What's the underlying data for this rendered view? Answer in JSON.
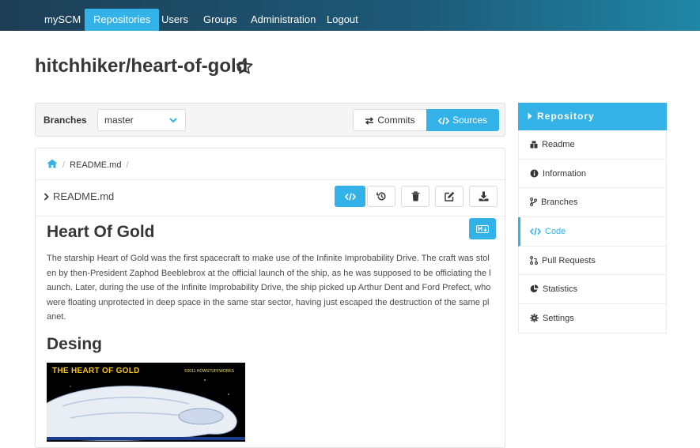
{
  "nav": {
    "brand": "mySCM",
    "items": [
      "Repositories",
      "Users",
      "Groups",
      "Administration",
      "Logout"
    ],
    "active": "Repositories"
  },
  "repo": {
    "title": "hitchhiker/heart-of-gold"
  },
  "branches": {
    "label": "Branches",
    "selected": "master"
  },
  "view_toggle": {
    "commits_label": "Commits",
    "sources_label": "Sources",
    "active": "Sources"
  },
  "breadcrumb": {
    "file": "README.md",
    "separator": "/"
  },
  "file": {
    "name": "README.md",
    "actions": [
      "code-icon",
      "history-icon",
      "trash-icon",
      "edit-icon",
      "download-icon"
    ]
  },
  "content": {
    "h1": "Heart Of Gold",
    "paragraph": "The starship Heart of Gold was the first spacecraft to make use of the Infinite Improbability Drive. The craft was stolen by then-President Zaphod Beeblebrox at the official launch of the ship, as he was supposed to be officiating the launch. Later, during the use of the Infinite Improbability Drive, the ship picked up Arthur Dent and Ford Prefect, who were floating unprotected in deep space in the same star sector, having just escaped the destruction of the same planet.",
    "h2": "Desing",
    "image_title": "THE HEART OF GOLD",
    "image_credit": "©2011 HOWSTUFFWORKS"
  },
  "sidebar": {
    "header": "Repository",
    "items": [
      {
        "label": "Readme",
        "icon": "readme-icon"
      },
      {
        "label": "Information",
        "icon": "info-icon"
      },
      {
        "label": "Branches",
        "icon": "branch-icon"
      },
      {
        "label": "Code",
        "icon": "code-icon"
      },
      {
        "label": "Pull Requests",
        "icon": "pull-request-icon"
      },
      {
        "label": "Statistics",
        "icon": "chart-icon"
      },
      {
        "label": "Settings",
        "icon": "gear-icon"
      }
    ],
    "active": "Code"
  },
  "colors": {
    "accent": "#33b2e8",
    "nav_start": "#1d3e55",
    "nav_end": "#1f86a5",
    "text": "#363636"
  }
}
